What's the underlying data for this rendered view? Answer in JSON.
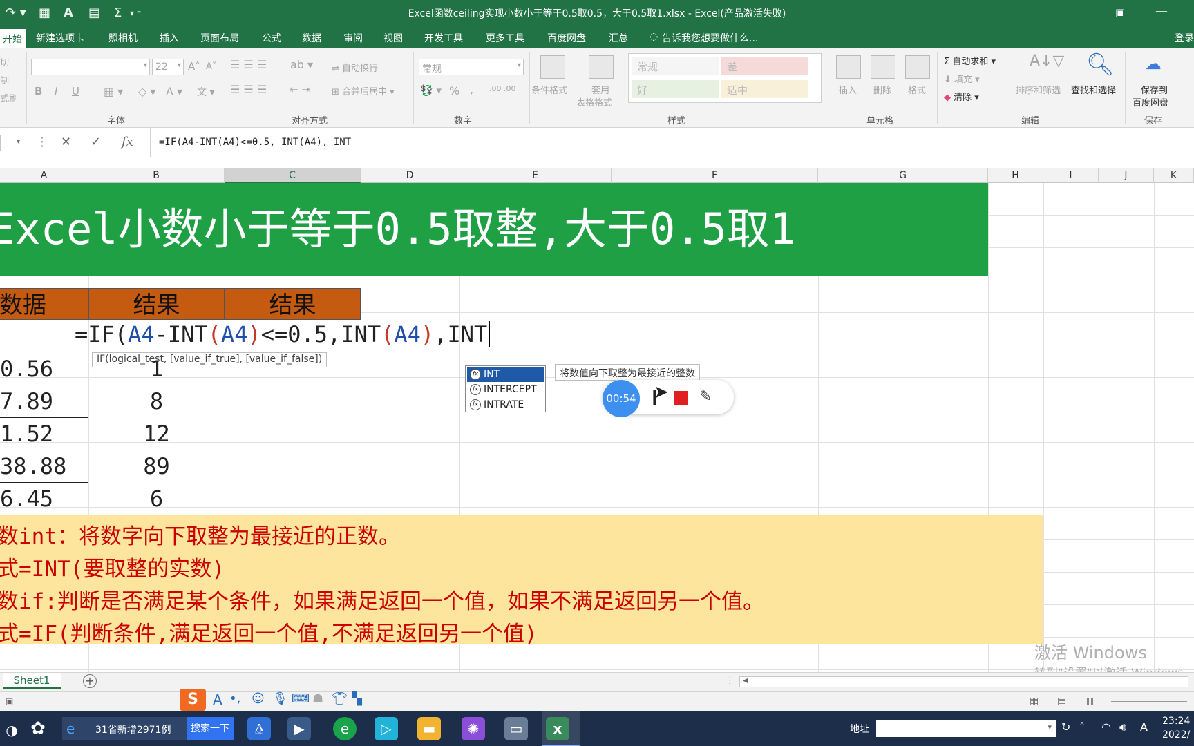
{
  "window": {
    "title": "Excel函数ceiling实现小数小于等于0.5取0.5，大于0.5取1.xlsx - Excel(产品激活失败)",
    "quick_access": {
      "format_icon": "A",
      "sum_icon": "Σ"
    }
  },
  "menu": {
    "tabs": [
      "开始",
      "新建选项卡",
      "照相机",
      "插入",
      "页面布局",
      "公式",
      "数据",
      "审阅",
      "视图",
      "开发工具",
      "更多工具",
      "百度网盘",
      "汇总"
    ],
    "tell_me": "告诉我您想要做什么...",
    "login": "登录"
  },
  "ribbon": {
    "clipboard": {
      "cut": "切",
      "copy": "制",
      "format": "式刷"
    },
    "font": {
      "size": "22",
      "bold": "B",
      "italic": "I",
      "underline": "U",
      "group_label": "字体"
    },
    "alignment": {
      "wrap": "自动换行",
      "merge": "合并后居中",
      "group_label": "对齐方式"
    },
    "number": {
      "format": "常规",
      "percent": "%",
      "comma": ",",
      "group_label": "数字"
    },
    "styles": {
      "conditional": "条件格式",
      "table_format_1": "套用",
      "table_format_2": "表格格式",
      "cells": [
        "常规",
        "差",
        "好",
        "适中"
      ],
      "group_label": "样式"
    },
    "cells": {
      "insert": "插入",
      "delete": "删除",
      "format": "格式",
      "group_label": "单元格"
    },
    "editing": {
      "autosum": "自动求和",
      "fill": "填充",
      "clear": "清除",
      "sort": "排序和筛选",
      "find": "查找和选择",
      "group_label": "编辑"
    },
    "save": {
      "line1": "保存到",
      "line2": "百度网盘",
      "group_label": "保存"
    }
  },
  "formula_bar": {
    "fx": "fx",
    "content": "=IF(A4-INT(A4)<=0.5, INT(A4), INT"
  },
  "columns": [
    "A",
    "B",
    "C",
    "D",
    "E",
    "F",
    "G",
    "H",
    "I",
    "J",
    "K"
  ],
  "sheet": {
    "banner": "Excel小数小于等于0.5取整,大于0.5取1",
    "headers": [
      "数据",
      "结果",
      "结果"
    ],
    "edit": {
      "eq_if": "=IF(",
      "a4_1": "A4",
      "minus_int": "-INT",
      "lp1": "(",
      "a4_2": "A4",
      "rp1": ")",
      "cmp": "<=0.5,INT",
      "lp2": "(",
      "a4_3": "A4",
      "rp2": ")",
      "tail": ",INT"
    },
    "arg_tip": "IF(logical_test, [value_if_true], [value_if_false])",
    "rows": [
      {
        "a": "0.56",
        "b": "1"
      },
      {
        "a": "7.89",
        "b": "8"
      },
      {
        "a": "1.52",
        "b": "12"
      },
      {
        "a": "38.88",
        "b": "89"
      },
      {
        "a": "6.45",
        "b": "6"
      }
    ],
    "notes": [
      "数int：将数字向下取整为最接近的正数。",
      "式=INT(要取整的实数)",
      "数if:判断是否满足某个条件，如果满足返回一个值，如果不满足返回另一个值。",
      "式=IF(判断条件,满足返回一个值,不满足返回另一个值)"
    ]
  },
  "autocomplete": {
    "items": [
      "INT",
      "INTERCEPT",
      "INTRATE"
    ],
    "selected": 0,
    "tip": "将数值向下取整为最接近的整数",
    "fx_glyph": "fx"
  },
  "recorder": {
    "time": "00:54"
  },
  "watermark": {
    "line1": "激活 Windows",
    "line2": "转到\"设置\"以激活 Windows。"
  },
  "sheet_tabs": {
    "active": "Sheet1",
    "add": "+"
  },
  "taskbar": {
    "news": "31省新增2971例",
    "search_btn": "搜索一下",
    "address_label": "地址",
    "time": "23:24",
    "date": "2022/"
  },
  "colors": {
    "excel_green": "#217346",
    "banner_green": "#1fa045",
    "header_orange": "#c55a11",
    "note_bg": "#fde59e",
    "note_text": "#cc0000"
  }
}
